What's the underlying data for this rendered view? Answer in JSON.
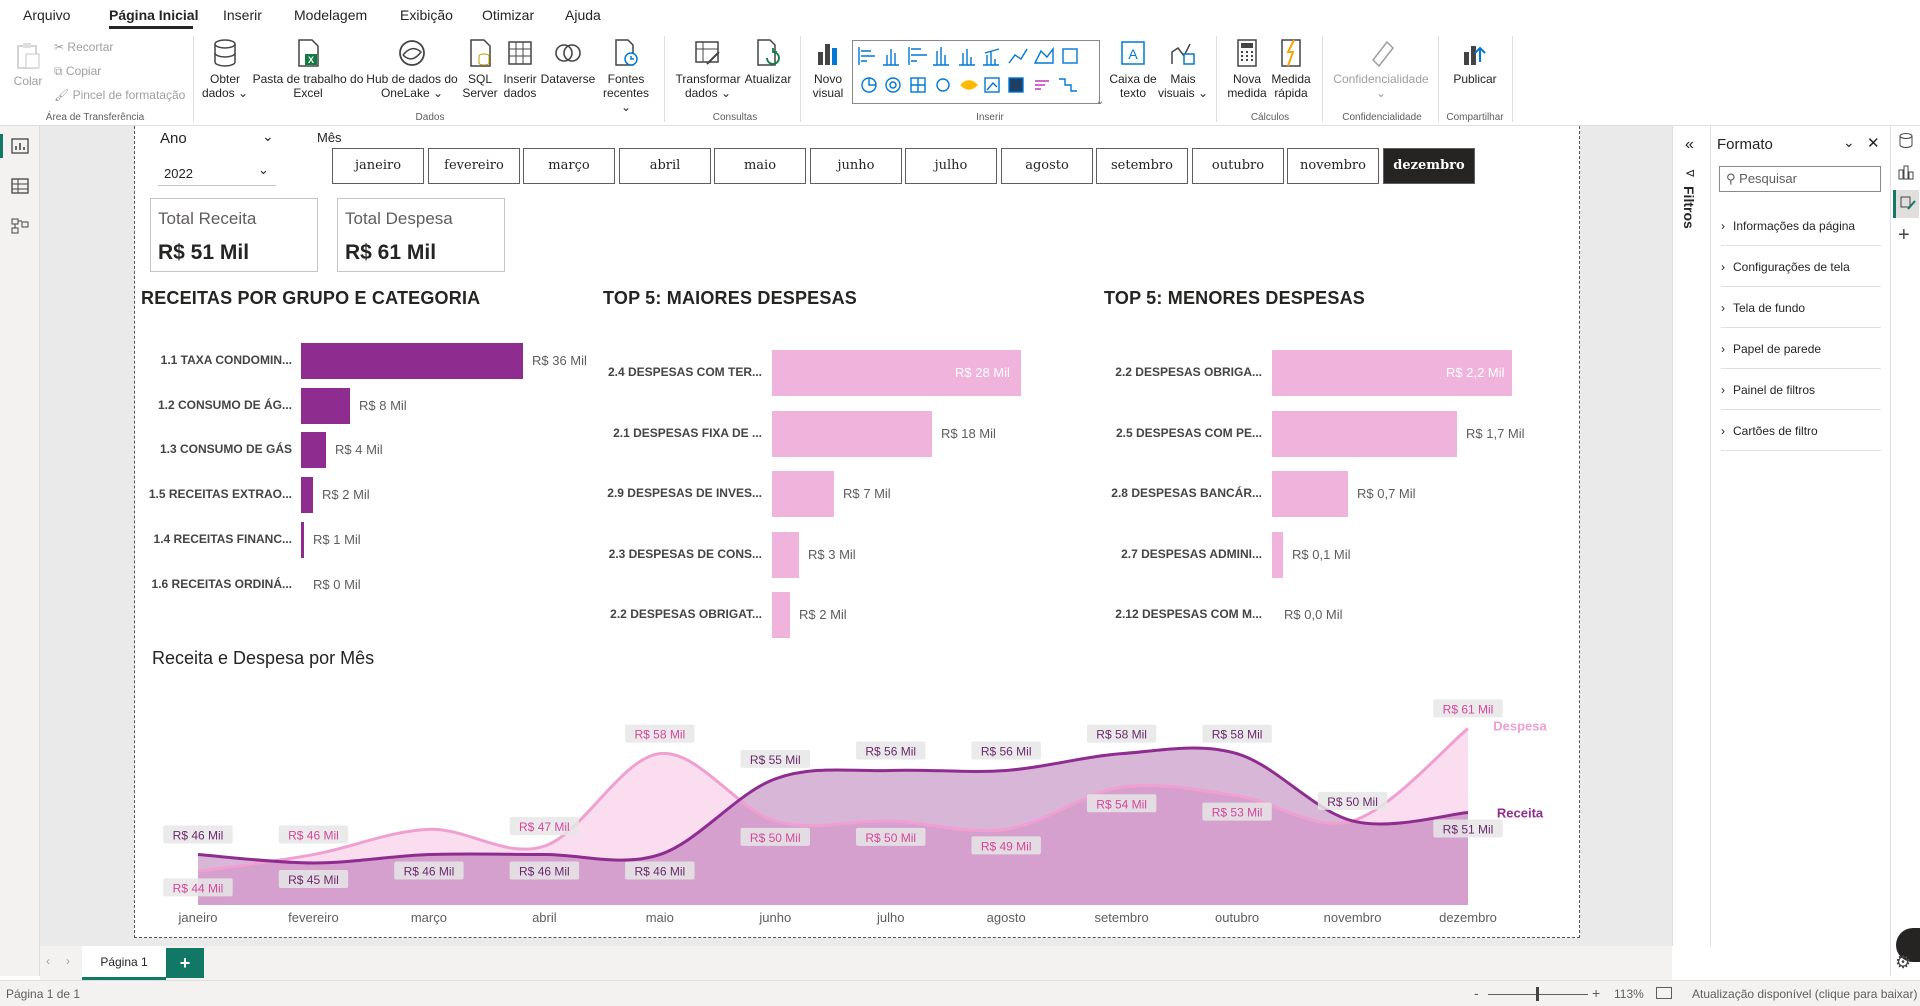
{
  "menu": {
    "items": [
      "Arquivo",
      "Página Inicial",
      "Inserir",
      "Modelagem",
      "Exibição",
      "Otimizar",
      "Ajuda"
    ],
    "active": "Página Inicial"
  },
  "ribbon": {
    "colar": "Colar",
    "recortar": "Recortar",
    "copiar": "Copiar",
    "pincel": "Pincel de formatação",
    "group_transfer": "Área de Transferência",
    "obter": "Obter",
    "obter2": "dados ⌄",
    "pasta": "Pasta de trabalho do",
    "pasta2": "Excel",
    "hub": "Hub de dados do",
    "hub2": "OneLake ⌄",
    "sql": "SQL",
    "sql2": "Server",
    "inserir_dados": "Inserir",
    "inserir_dados2": "dados",
    "dataverse": "Dataverse",
    "fontes": "Fontes",
    "fontes2": "recentes ⌄",
    "group_dados": "Dados",
    "transformar": "Transformar",
    "transformar2": "dados ⌄",
    "atualizar": "Atualizar",
    "group_consultas": "Consultas",
    "novo_visual": "Novo",
    "novo_visual2": "visual",
    "group_inserir": "Inserir",
    "caixa_texto": "Caixa de",
    "caixa_texto2": "texto",
    "mais_visuais": "Mais",
    "mais_visuais2": "visuais ⌄",
    "nova_medida": "Nova",
    "nova_medida2": "medida",
    "medida_rapida": "Medida",
    "medida_rapida2": "rápida",
    "group_calculos": "Cálculos",
    "confidencialidade": "Confidencialidade",
    "confidencialidade2": "⌄",
    "group_conf": "Confidencialidade",
    "publicar": "Publicar",
    "group_compartilhar": "Compartilhar"
  },
  "slicers": {
    "ano_label": "Ano",
    "ano_value": "2022",
    "mes_label": "Mês",
    "months": [
      "janeiro",
      "fevereiro",
      "março",
      "abril",
      "maio",
      "junho",
      "julho",
      "agosto",
      "setembro",
      "outubro",
      "novembro",
      "dezembro"
    ],
    "selected_month": "dezembro"
  },
  "kpis": {
    "receita_label": "Total Receita",
    "receita_value": "R$ 51 Mil",
    "despesa_label": "Total Despesa",
    "despesa_value": "R$ 61 Mil"
  },
  "bar_charts": [
    {
      "title": "RECEITAS POR GRUPO E CATEGORIA",
      "color": "#8e2d8f",
      "max": 36,
      "bars": [
        {
          "label": "1.1 TAXA CONDOMIN...",
          "value": 36,
          "text": "R$ 36 Mil"
        },
        {
          "label": "1.2 CONSUMO DE ÁG...",
          "value": 8,
          "text": "R$ 8 Mil"
        },
        {
          "label": "1.3 CONSUMO DE GÁS",
          "value": 4,
          "text": "R$ 4 Mil"
        },
        {
          "label": "1.5 RECEITAS EXTRAO...",
          "value": 2,
          "text": "R$ 2 Mil"
        },
        {
          "label": "1.4 RECEITAS FINANC...",
          "value": 0.5,
          "text": "R$ 1 Mil"
        },
        {
          "label": "1.6 RECEITAS ORDINÁ...",
          "value": 0,
          "text": "R$ 0 Mil"
        }
      ]
    },
    {
      "title": "TOP 5: MAIORES DESPESAS",
      "color": "#f0b3dc",
      "max": 28,
      "bars": [
        {
          "label": "2.4 DESPESAS COM TER...",
          "value": 28,
          "text": "R$ 28 Mil"
        },
        {
          "label": "2.1 DESPESAS FIXA DE ...",
          "value": 18,
          "text": "R$ 18 Mil"
        },
        {
          "label": "2.9 DESPESAS DE INVES...",
          "value": 7,
          "text": "R$ 7 Mil"
        },
        {
          "label": "2.3 DESPESAS DE CONS...",
          "value": 3,
          "text": "R$ 3 Mil"
        },
        {
          "label": "2.2 DESPESAS OBRIGAT...",
          "value": 2,
          "text": "R$ 2 Mil"
        }
      ]
    },
    {
      "title": "TOP 5: MENORES DESPESAS",
      "color": "#f0b3dc",
      "max": 2.2,
      "bars": [
        {
          "label": "2.2 DESPESAS OBRIGA...",
          "value": 2.2,
          "text": "R$ 2,2 Mil"
        },
        {
          "label": "2.5 DESPESAS COM PE...",
          "value": 1.7,
          "text": "R$ 1,7 Mil"
        },
        {
          "label": "2.8 DESPESAS BANCÁR...",
          "value": 0.7,
          "text": "R$ 0,7 Mil"
        },
        {
          "label": "2.7 DESPESAS ADMINI...",
          "value": 0.1,
          "text": "R$ 0,1 Mil"
        },
        {
          "label": "2.12 DESPESAS COM M...",
          "value": 0,
          "text": "R$ 0,0 Mil"
        }
      ]
    }
  ],
  "chart_data": {
    "type": "area",
    "title": "Receita e Despesa por Mês",
    "categories": [
      "janeiro",
      "fevereiro",
      "março",
      "abril",
      "maio",
      "junho",
      "julho",
      "agosto",
      "setembro",
      "outubro",
      "novembro",
      "dezembro"
    ],
    "series": [
      {
        "name": "Receita",
        "color": "#8e2d8f",
        "values": [
          46,
          45,
          46,
          46,
          46,
          55,
          56,
          56,
          58,
          58,
          50,
          51
        ],
        "labels": [
          "R$ 46 Mil",
          "R$ 45 Mil",
          "R$ 46 Mil",
          "R$ 46 Mil",
          "R$ 46 Mil",
          "R$ 55 Mil",
          "R$ 56 Mil",
          "R$ 56 Mil",
          "R$ 58 Mil",
          "R$ 58 Mil",
          "R$ 50 Mil",
          "R$ 51 Mil"
        ]
      },
      {
        "name": "Despesa",
        "color": "#f0a0d0",
        "values": [
          44,
          46,
          49,
          47,
          58,
          50,
          50,
          49,
          54,
          53,
          50,
          61
        ],
        "labels": [
          "R$ 44 Mil",
          "R$ 46 Mil",
          "",
          "R$ 47 Mil",
          "R$ 58 Mil",
          "R$ 50 Mil",
          "R$ 50 Mil",
          "R$ 49 Mil",
          "R$ 54 Mil",
          "R$ 53 Mil",
          "",
          "R$ 61 Mil"
        ]
      }
    ]
  },
  "filters_pane": {
    "label": "Filtros"
  },
  "format_pane": {
    "title": "Formato",
    "search_placeholder": "Pesquisar",
    "items": [
      "Informações da página",
      "Configurações de tela",
      "Tela de fundo",
      "Papel de parede",
      "Painel de filtros",
      "Cartões de filtro"
    ]
  },
  "tabs": {
    "page": "Página 1",
    "add": "+"
  },
  "status": {
    "page_count": "Página 1 de 1",
    "zoom": "113%",
    "update": "Atualização disponível (clique para baixar)",
    "zoom_minus": "-",
    "zoom_plus": "+"
  },
  "colors": {
    "receita": "#8e2d8f",
    "despesa": "#f0b3dc",
    "accent": "#117865"
  }
}
